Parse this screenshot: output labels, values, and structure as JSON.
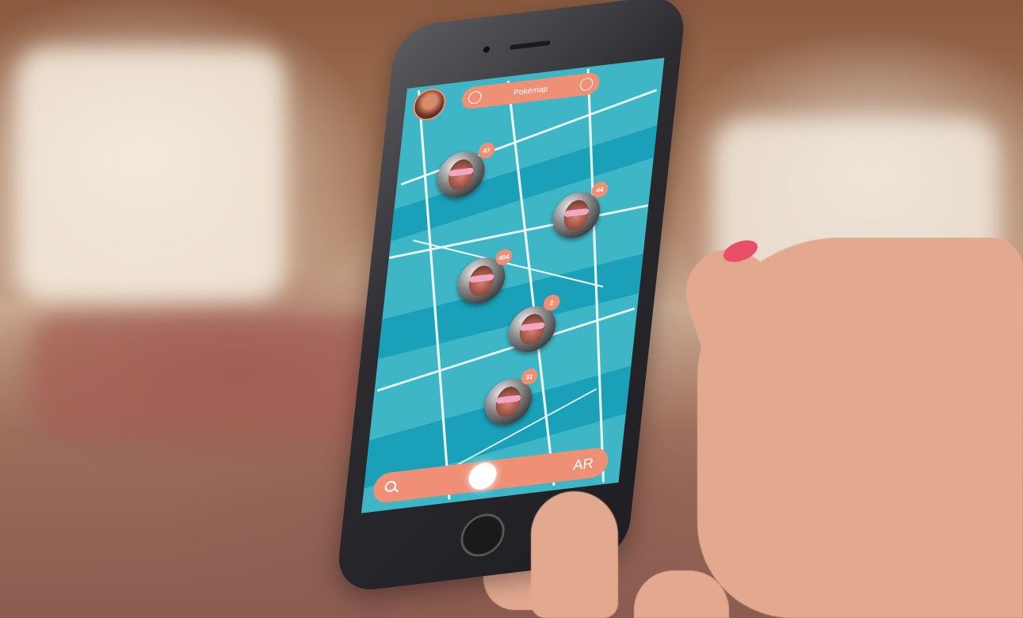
{
  "app": {
    "header_title": "Pokémap",
    "ar_label": "AR"
  },
  "pins": [
    {
      "badge": "47"
    },
    {
      "badge": "44"
    },
    {
      "badge": "404"
    },
    {
      "badge": "2"
    },
    {
      "badge": "31"
    }
  ],
  "colors": {
    "accent": "#ee8f76",
    "map_water": "#1aa0b9",
    "map_land": "#3fb6c6"
  },
  "icons": {
    "search": "search-icon",
    "history": "clock-icon",
    "settings": "gear-icon"
  }
}
